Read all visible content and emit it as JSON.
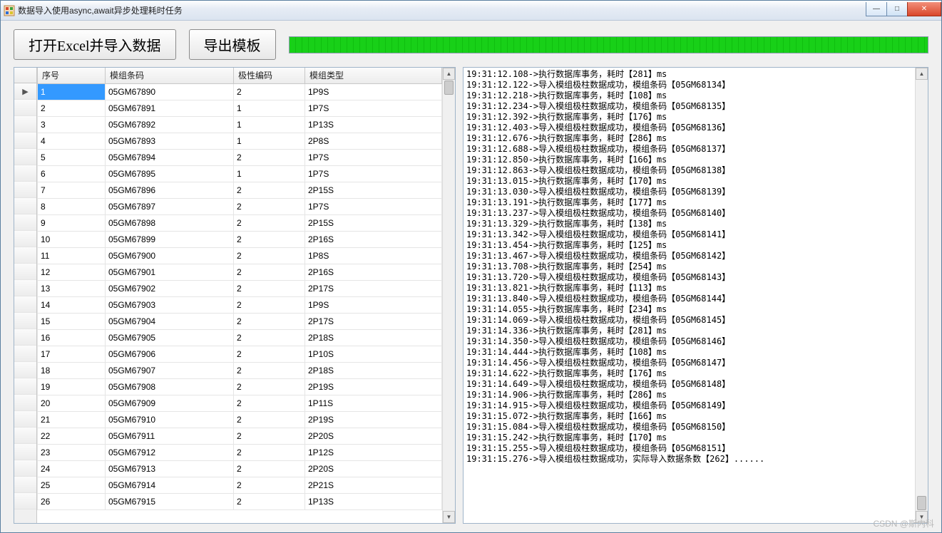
{
  "window": {
    "title": "数据导入使用async,await异步处理耗时任务"
  },
  "toolbar": {
    "open_label": "打开Excel并导入数据",
    "export_label": "导出模板",
    "progress_percent": 100
  },
  "grid": {
    "columns": [
      "序号",
      "模组条码",
      "极性编码",
      "模组类型"
    ],
    "rows": [
      [
        "1",
        "05GM67890",
        "2",
        "1P9S"
      ],
      [
        "2",
        "05GM67891",
        "1",
        "1P7S"
      ],
      [
        "3",
        "05GM67892",
        "1",
        "1P13S"
      ],
      [
        "4",
        "05GM67893",
        "1",
        "2P8S"
      ],
      [
        "5",
        "05GM67894",
        "2",
        "1P7S"
      ],
      [
        "6",
        "05GM67895",
        "1",
        "1P7S"
      ],
      [
        "7",
        "05GM67896",
        "2",
        "2P15S"
      ],
      [
        "8",
        "05GM67897",
        "2",
        "1P7S"
      ],
      [
        "9",
        "05GM67898",
        "2",
        "2P15S"
      ],
      [
        "10",
        "05GM67899",
        "2",
        "2P16S"
      ],
      [
        "11",
        "05GM67900",
        "2",
        "1P8S"
      ],
      [
        "12",
        "05GM67901",
        "2",
        "2P16S"
      ],
      [
        "13",
        "05GM67902",
        "2",
        "2P17S"
      ],
      [
        "14",
        "05GM67903",
        "2",
        "1P9S"
      ],
      [
        "15",
        "05GM67904",
        "2",
        "2P17S"
      ],
      [
        "16",
        "05GM67905",
        "2",
        "2P18S"
      ],
      [
        "17",
        "05GM67906",
        "2",
        "1P10S"
      ],
      [
        "18",
        "05GM67907",
        "2",
        "2P18S"
      ],
      [
        "19",
        "05GM67908",
        "2",
        "2P19S"
      ],
      [
        "20",
        "05GM67909",
        "2",
        "1P11S"
      ],
      [
        "21",
        "05GM67910",
        "2",
        "2P19S"
      ],
      [
        "22",
        "05GM67911",
        "2",
        "2P20S"
      ],
      [
        "23",
        "05GM67912",
        "2",
        "1P12S"
      ],
      [
        "24",
        "05GM67913",
        "2",
        "2P20S"
      ],
      [
        "25",
        "05GM67914",
        "2",
        "2P21S"
      ],
      [
        "26",
        "05GM67915",
        "2",
        "1P13S"
      ]
    ],
    "selected_index": 0
  },
  "log": [
    "19:31:12.108->执行数据库事务，耗时【281】ms",
    "19:31:12.122->导入模组极柱数据成功，模组条码【05GM68134】",
    "19:31:12.218->执行数据库事务，耗时【108】ms",
    "19:31:12.234->导入模组极柱数据成功，模组条码【05GM68135】",
    "19:31:12.392->执行数据库事务，耗时【176】ms",
    "19:31:12.403->导入模组极柱数据成功，模组条码【05GM68136】",
    "19:31:12.676->执行数据库事务，耗时【286】ms",
    "19:31:12.688->导入模组极柱数据成功，模组条码【05GM68137】",
    "19:31:12.850->执行数据库事务，耗时【166】ms",
    "19:31:12.863->导入模组极柱数据成功，模组条码【05GM68138】",
    "19:31:13.015->执行数据库事务，耗时【170】ms",
    "19:31:13.030->导入模组极柱数据成功，模组条码【05GM68139】",
    "19:31:13.191->执行数据库事务，耗时【177】ms",
    "19:31:13.237->导入模组极柱数据成功，模组条码【05GM68140】",
    "19:31:13.329->执行数据库事务，耗时【138】ms",
    "19:31:13.342->导入模组极柱数据成功，模组条码【05GM68141】",
    "19:31:13.454->执行数据库事务，耗时【125】ms",
    "19:31:13.467->导入模组极柱数据成功，模组条码【05GM68142】",
    "19:31:13.708->执行数据库事务，耗时【254】ms",
    "19:31:13.720->导入模组极柱数据成功，模组条码【05GM68143】",
    "19:31:13.821->执行数据库事务，耗时【113】ms",
    "19:31:13.840->导入模组极柱数据成功，模组条码【05GM68144】",
    "19:31:14.055->执行数据库事务，耗时【234】ms",
    "19:31:14.069->导入模组极柱数据成功，模组条码【05GM68145】",
    "19:31:14.336->执行数据库事务，耗时【281】ms",
    "19:31:14.350->导入模组极柱数据成功，模组条码【05GM68146】",
    "19:31:14.444->执行数据库事务，耗时【108】ms",
    "19:31:14.456->导入模组极柱数据成功，模组条码【05GM68147】",
    "19:31:14.622->执行数据库事务，耗时【176】ms",
    "19:31:14.649->导入模组极柱数据成功，模组条码【05GM68148】",
    "19:31:14.906->执行数据库事务，耗时【286】ms",
    "19:31:14.915->导入模组极柱数据成功，模组条码【05GM68149】",
    "19:31:15.072->执行数据库事务，耗时【166】ms",
    "19:31:15.084->导入模组极柱数据成功，模组条码【05GM68150】",
    "19:31:15.242->执行数据库事务，耗时【170】ms",
    "19:31:15.255->导入模组极柱数据成功，模组条码【05GM68151】",
    "19:31:15.276->导入模组极柱数据成功，实际导入数据条数【262】......"
  ],
  "watermark": "CSDN @斯内科"
}
